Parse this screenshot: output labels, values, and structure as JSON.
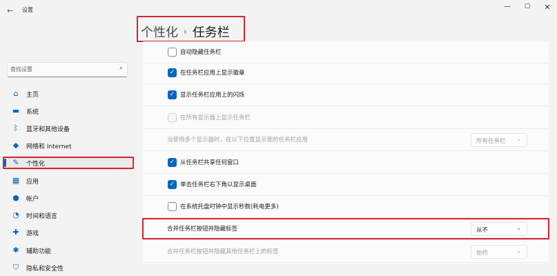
{
  "window": {
    "title": "设置",
    "back_glyph": "←",
    "min_glyph": "—",
    "max_glyph": "▢",
    "close_glyph": "✕"
  },
  "search": {
    "placeholder": "查找设置",
    "icon": "search-icon"
  },
  "sidebar": {
    "items": [
      {
        "label": "主页",
        "icon": "home-icon",
        "glyph": "⌂"
      },
      {
        "label": "系统",
        "icon": "system-monitor-icon",
        "glyph": "▬"
      },
      {
        "label": "蓝牙和其他设备",
        "icon": "bluetooth-icon",
        "glyph": "ᛒ"
      },
      {
        "label": "网络和 Internet",
        "icon": "wifi-icon",
        "glyph": "◆"
      },
      {
        "label": "个性化",
        "icon": "brush-icon",
        "glyph": "✎"
      },
      {
        "label": "应用",
        "icon": "apps-icon",
        "glyph": "▦"
      },
      {
        "label": "帐户",
        "icon": "account-icon",
        "glyph": "●"
      },
      {
        "label": "时间和语言",
        "icon": "globe-clock-icon",
        "glyph": "◔"
      },
      {
        "label": "游戏",
        "icon": "gamepad-icon",
        "glyph": "✚"
      },
      {
        "label": "辅助功能",
        "icon": "accessibility-icon",
        "glyph": "✱"
      },
      {
        "label": "隐私和安全性",
        "icon": "shield-icon",
        "glyph": "⛉"
      }
    ],
    "active_index": 4
  },
  "breadcrumb": {
    "parent": "个性化",
    "separator": "›",
    "current": "任务栏"
  },
  "settings": {
    "rows": [
      {
        "type": "checkbox",
        "label": "自动隐藏任务栏",
        "checked": false,
        "disabled": false
      },
      {
        "type": "checkbox",
        "label": "在任务栏应用上显示徽章",
        "checked": true,
        "disabled": false
      },
      {
        "type": "checkbox",
        "label": "显示任务栏应用上的闪烁",
        "checked": true,
        "disabled": false
      },
      {
        "type": "checkbox",
        "label": "在所有显示器上显示任务栏",
        "checked": false,
        "disabled": true
      },
      {
        "type": "dropdown",
        "label": "当使用多个显示器时，在以下位置显示我的任务栏应用",
        "value": "所有任务栏",
        "disabled": true
      },
      {
        "type": "checkbox",
        "label": "从任务栏共享任何窗口",
        "checked": true,
        "disabled": false
      },
      {
        "type": "checkbox",
        "label": "单击任务栏右下角以显示桌面",
        "checked": true,
        "disabled": false
      },
      {
        "type": "checkbox",
        "label": "在系统托盘时钟中显示秒数(耗电更多)",
        "checked": false,
        "disabled": false
      },
      {
        "type": "dropdown",
        "label": "合并任务栏按钮并隐藏标签",
        "value": "从不",
        "disabled": false
      },
      {
        "type": "dropdown",
        "label": "合并任务栏按钮并隐藏其他任务栏上的标签",
        "value": "始终",
        "disabled": true
      }
    ],
    "check_glyph": "✓",
    "chevron_glyph": "⌄"
  },
  "colors": {
    "accent": "#0067c0",
    "highlight_box": "#d6232c"
  }
}
